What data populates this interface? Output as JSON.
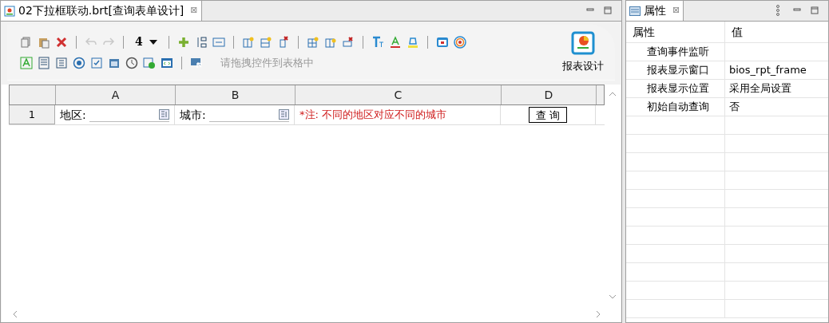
{
  "editor": {
    "tab": {
      "title": "02下拉框联动.brt[查询表单设计]",
      "close": "⊠",
      "selected": true
    },
    "toolbar": {
      "undo": {
        "disabled": true
      },
      "redo": {
        "disabled": true
      },
      "font_size": "4",
      "hint": "请拖拽控件到表格中",
      "design_button": "报表设计"
    },
    "grid": {
      "columns": [
        "A",
        "B",
        "C",
        "D"
      ],
      "rows": [
        {
          "header": "1",
          "cells": [
            {
              "kind": "field",
              "label": "地区:"
            },
            {
              "kind": "field",
              "label": "城市:"
            },
            {
              "kind": "note",
              "text": "*注: 不同的地区对应不同的城市"
            },
            {
              "kind": "button",
              "text": "查 询"
            }
          ]
        }
      ]
    }
  },
  "properties": {
    "tab": {
      "title": "属性",
      "close": "⊠",
      "selected": true
    },
    "columns": [
      "属性",
      "值"
    ],
    "rows": [
      {
        "name": "查询事件监听"
      },
      {
        "name": "报表显示窗口",
        "value": "bios_rpt_frame"
      },
      {
        "name": "报表显示位置",
        "value": "采用全局设置"
      },
      {
        "name": "初始自动查询",
        "value": "否"
      }
    ]
  }
}
